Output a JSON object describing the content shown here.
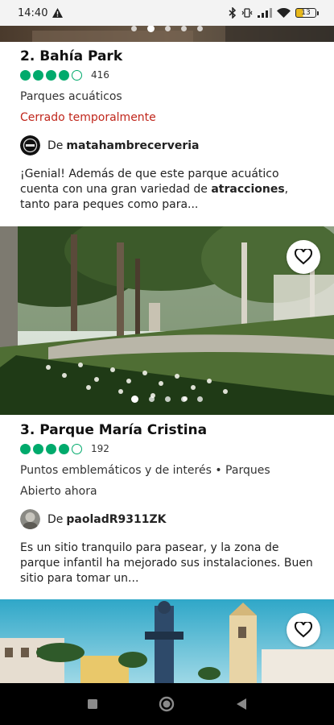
{
  "status_bar": {
    "time": "14:40",
    "battery": "13"
  },
  "cards": [
    {
      "rank_title": "2. Bahía Park",
      "rating": 4,
      "review_count": "416",
      "category": "Parques acuáticos",
      "status": "Cerrado temporalmente",
      "author_prefix": "De",
      "author": "matahambrecerveria",
      "review_pre": "¡Genial! Además de que este parque acuático cuenta con una gran variedad de ",
      "review_bold": "atracciones",
      "review_post": ", tanto para peques como para..."
    },
    {
      "rank_title": "3. Parque María Cristina",
      "rating": 4,
      "review_count": "192",
      "category": "Puntos emblemáticos y de interés • Parques",
      "status": "Abierto ahora",
      "author_prefix": "De",
      "author": "paoladR9311ZK",
      "review": "Es un sitio tranquilo para pasear, y la zona de parque infantil ha mejorado sus instalaciones. Buen sitio para tomar un..."
    }
  ],
  "carousel": {
    "dot_count": 5,
    "top_active_index": 1,
    "middle_active_index": 0
  },
  "colors": {
    "rating_green": "#00aa6c",
    "closed_red": "#c0261b"
  }
}
